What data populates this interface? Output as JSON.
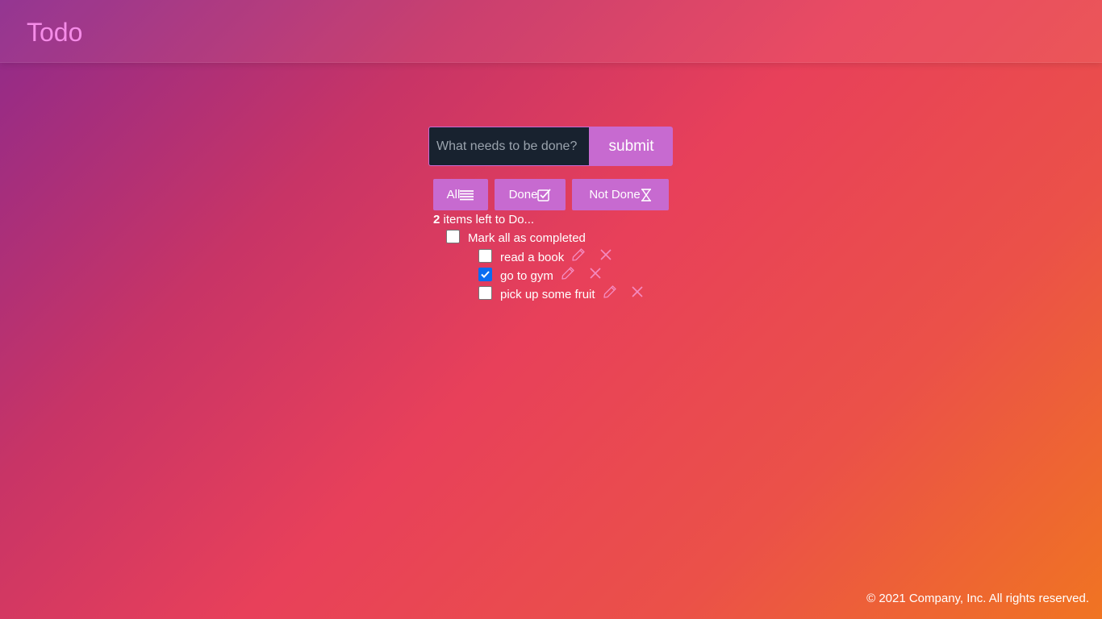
{
  "header": {
    "title": "Todo"
  },
  "new_todo": {
    "placeholder": "What needs to be done?",
    "value": "",
    "submit_label": "submit"
  },
  "filters": [
    {
      "label": "All",
      "icon": "list-icon"
    },
    {
      "label": "Done",
      "icon": "checkbox-check-icon"
    },
    {
      "label": "Not Done",
      "icon": "hourglass-icon"
    }
  ],
  "status": {
    "items_left_count": "2",
    "items_left_text": " items left to Do..."
  },
  "mark_all": {
    "label": "Mark all as completed",
    "checked": false
  },
  "todos": [
    {
      "text": "read a book",
      "done": false
    },
    {
      "text": "go to gym",
      "done": true
    },
    {
      "text": "pick up some fruit",
      "done": false
    }
  ],
  "footer": {
    "text": "© 2021 Company, Inc. All rights reserved."
  },
  "colors": {
    "accent": "#c76ad0",
    "title": "#f58ce8",
    "input_bg": "#18222f",
    "icon_pink": "#f48bc0",
    "checkbox_checked": "#0a6cf1"
  }
}
